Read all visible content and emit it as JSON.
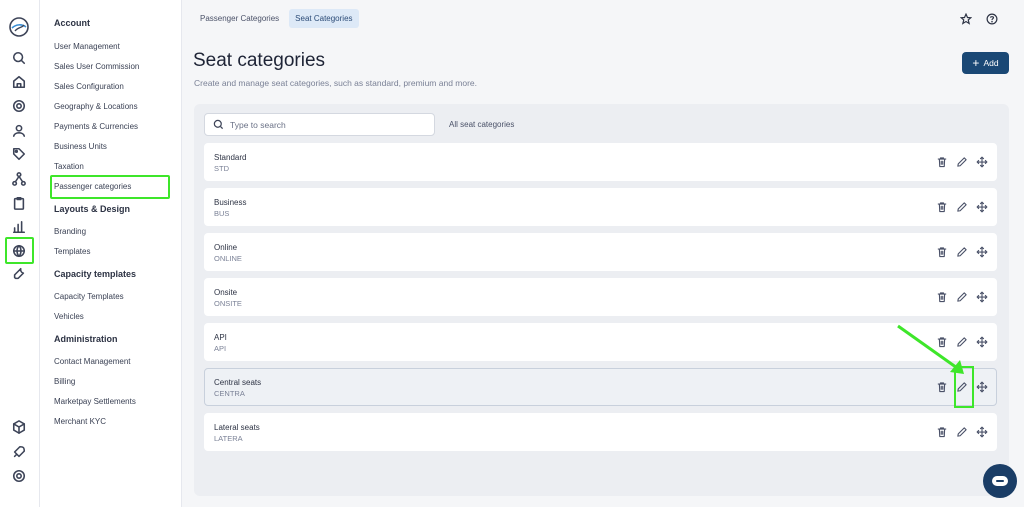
{
  "rail": {
    "icons": [
      "logo-icon",
      "search-icon",
      "home-icon",
      "settings-icon",
      "users-icon",
      "tag-icon",
      "network-icon",
      "clipboard-icon",
      "chart-icon",
      "globe-icon",
      "wrench-icon",
      "cube-icon",
      "rocket-icon",
      "lifebuoy-icon"
    ],
    "active": "globe-icon"
  },
  "menu": {
    "section_account": "Account",
    "account_items": [
      "User Management",
      "Sales User Commission",
      "Sales Configuration",
      "Geography & Locations",
      "Payments & Currencies",
      "Business Units",
      "Taxation",
      "Passenger categories"
    ],
    "section_layouts": "Layouts & Design",
    "layout_items": [
      "Branding",
      "Templates"
    ],
    "section_capacity": "Capacity templates",
    "capacity_items": [
      "Capacity Templates",
      "Vehicles"
    ],
    "section_admin": "Administration",
    "admin_items": [
      "Contact Management",
      "Billing",
      "Marketpay Settlements",
      "Merchant KYC"
    ]
  },
  "tabs": [
    {
      "label": "Passenger Categories",
      "active": false
    },
    {
      "label": "Seat Categories",
      "active": true
    }
  ],
  "page": {
    "title": "Seat categories",
    "subtitle": "Create and manage seat categories, such as standard, premium and more.",
    "add_label": "Add"
  },
  "search": {
    "placeholder": "Type to search"
  },
  "filter_label": "All seat categories",
  "rows": [
    {
      "name": "Standard",
      "code": "STD"
    },
    {
      "name": "Business",
      "code": "BUS"
    },
    {
      "name": "Online",
      "code": "ONLINE"
    },
    {
      "name": "Onsite",
      "code": "ONSITE"
    },
    {
      "name": "API",
      "code": "API"
    },
    {
      "name": "Central seats",
      "code": "CENTRA"
    },
    {
      "name": "Lateral seats",
      "code": "LATERA"
    }
  ],
  "colors": {
    "accent": "#1a4875",
    "annotation": "#3ee62a"
  }
}
